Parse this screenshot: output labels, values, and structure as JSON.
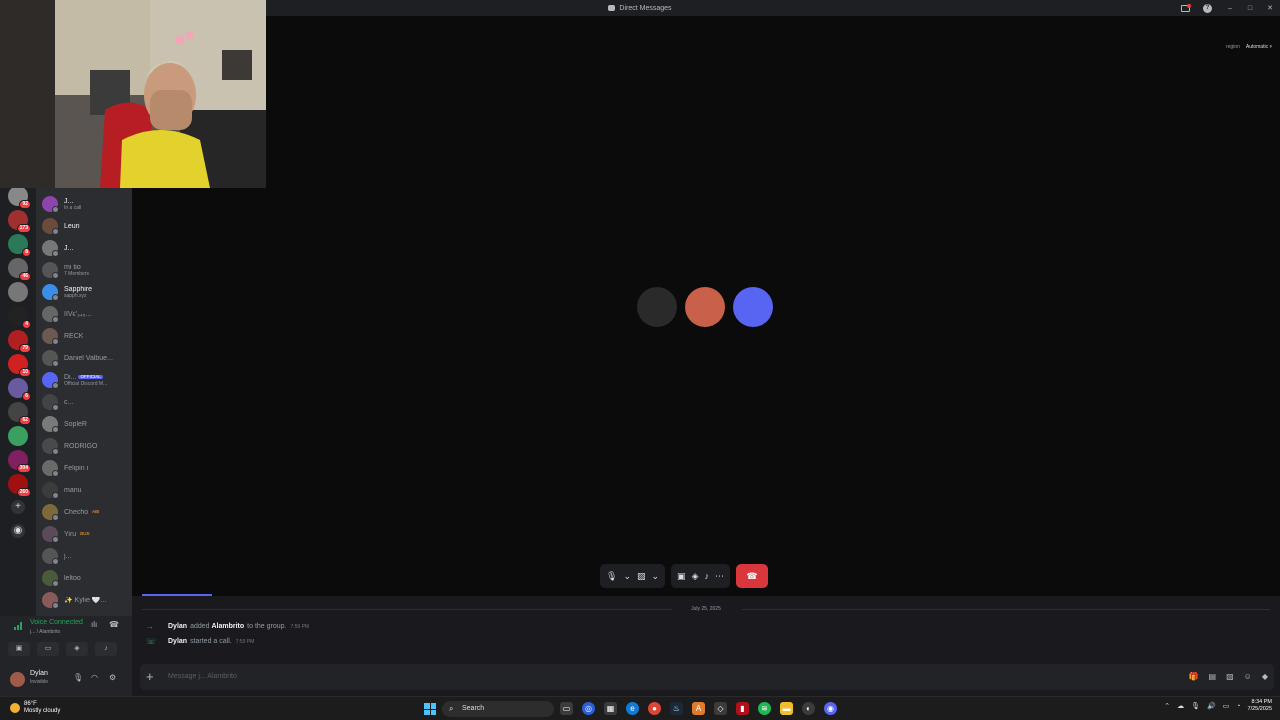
{
  "window": {
    "title": "Direct Messages"
  },
  "region": {
    "label": "region",
    "value": "Automatic"
  },
  "dms": [
    {
      "name": "J...",
      "sub": "In a call",
      "color": "#8e44ad",
      "bright": true
    },
    {
      "name": "Leuri",
      "sub": "",
      "color": "#6b4b3a",
      "bright": true
    },
    {
      "name": "J...",
      "sub": "",
      "color": "#777777",
      "bright": true
    },
    {
      "name": "mi tio",
      "sub": "7 Members",
      "color": "#555555",
      "bright": false
    },
    {
      "name": "Sapphire",
      "sub": "sapph.xyz",
      "color": "#3a8ee6",
      "bright": true
    },
    {
      "name": "IIVϵ′₃₄₅...",
      "sub": "",
      "color": "#666666",
      "bright": false
    },
    {
      "name": "RECK",
      "sub": "",
      "color": "#6c5a50",
      "bright": false
    },
    {
      "name": "Daniel Valbue...",
      "sub": "",
      "color": "#555555",
      "bright": false
    },
    {
      "name": "Di...",
      "sub": "Official Discord M...",
      "color": "#5865f2",
      "bright": false,
      "tag": "OFFICIAL"
    },
    {
      "name": "c...",
      "sub": "",
      "color": "#444444",
      "bright": false
    },
    {
      "name": "SopleR",
      "sub": "",
      "color": "#7a7a7a",
      "bright": false
    },
    {
      "name": "RODRIGO",
      "sub": "",
      "color": "#4a4a4a",
      "bright": false
    },
    {
      "name": "Felipin i",
      "sub": "",
      "color": "#6a6a6a",
      "bright": false
    },
    {
      "name": "manu",
      "sub": "",
      "color": "#3c3c3c",
      "bright": false
    },
    {
      "name": "Checho",
      "sub": "",
      "color": "#7d6a3a",
      "bright": false,
      "tag": "ABI"
    },
    {
      "name": "Yiru",
      "sub": "",
      "color": "#5a4a5a",
      "bright": false,
      "tag": "BUS"
    },
    {
      "name": "j...",
      "sub": "",
      "color": "#555555",
      "bright": false
    },
    {
      "name": "leltoo",
      "sub": "",
      "color": "#4b5a3a",
      "bright": false
    },
    {
      "name": "✨ Kylie 🤍...",
      "sub": "",
      "color": "#8a5a5a",
      "bright": false
    }
  ],
  "guilds": [
    {
      "color": "#888888",
      "badge": "92"
    },
    {
      "color": "#a03030",
      "badge": "173"
    },
    {
      "color": "#2a7a5a",
      "badge": "8"
    },
    {
      "color": "#666666",
      "badge": "46"
    },
    {
      "color": "#777777",
      "badge": ""
    },
    {
      "color": "#222222",
      "badge": "4"
    },
    {
      "color": "#b02020",
      "badge": "79"
    },
    {
      "color": "#d02020",
      "badge": "10"
    },
    {
      "color": "#6a5aa0",
      "badge": "6"
    },
    {
      "color": "#444444",
      "badge": "62"
    },
    {
      "color": "#3aa060",
      "badge": ""
    },
    {
      "color": "#802060",
      "badge": "304"
    },
    {
      "color": "#a01010",
      "badge": "260"
    }
  ],
  "voice": {
    "status": "Voice Connected",
    "channel": "j... / Alambrito"
  },
  "user": {
    "name": "Dylan",
    "status": "Invisible"
  },
  "chat": {
    "date": "July 25, 2025",
    "messages": [
      {
        "author": "Dylan",
        "text_a": "added",
        "target": "Alambrito",
        "text_b": "to the group.",
        "time": "7:59 PM"
      },
      {
        "author": "Dylan",
        "text_a": "started a call.",
        "target": "",
        "text_b": "",
        "time": "7:59 PM"
      }
    ],
    "placeholder": "Message j... Alambrito"
  },
  "taskbar": {
    "weather_temp": "86°F",
    "weather_text": "Mostly cloudy",
    "search": "Search",
    "time": "8:34 PM",
    "date": "7/25/2025"
  },
  "participants": [
    {
      "color": "#2a2a2a"
    },
    {
      "color": "#c8604a"
    },
    {
      "color": "#5865f2"
    }
  ]
}
